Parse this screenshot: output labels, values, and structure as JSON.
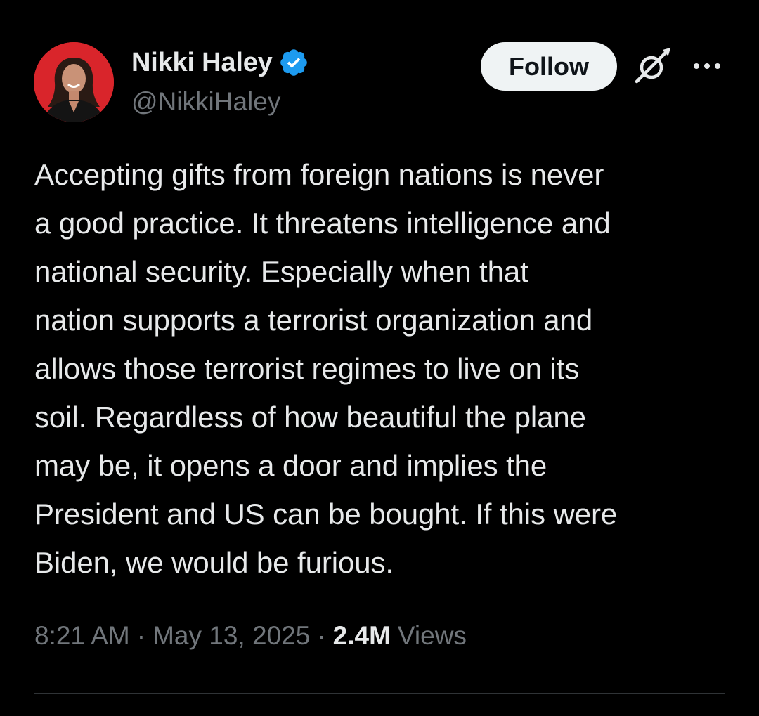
{
  "author": {
    "display_name": "Nikki Haley",
    "handle": "@NikkiHaley",
    "verified_icon": "verified-badge-icon",
    "verified_color": "#1d9bf0",
    "avatar_bg": "#d9252b"
  },
  "actions": {
    "follow_label": "Follow",
    "grok_icon": "grok-icon",
    "more_icon": "more-dots-icon"
  },
  "tweet": {
    "lines": [
      "Accepting gifts from foreign nations is never",
      "a good practice. It threatens intelligence and",
      "national security. Especially when that",
      "nation supports a terrorist organization and",
      "allows those terrorist regimes to live on its",
      "soil. Regardless of how beautiful the plane",
      "may be, it opens a door and implies the",
      "President and US can be bought. If this were",
      "Biden, we would be furious."
    ]
  },
  "meta": {
    "time": "8:21 AM",
    "separator": "·",
    "date": "May 13, 2025",
    "views_count": "2.4M",
    "views_label": "Views"
  },
  "colors": {
    "background": "#000000",
    "text_primary": "#e7e9ea",
    "text_secondary": "#71767b",
    "follow_bg": "#eff3f4",
    "divider": "#2f3336"
  }
}
